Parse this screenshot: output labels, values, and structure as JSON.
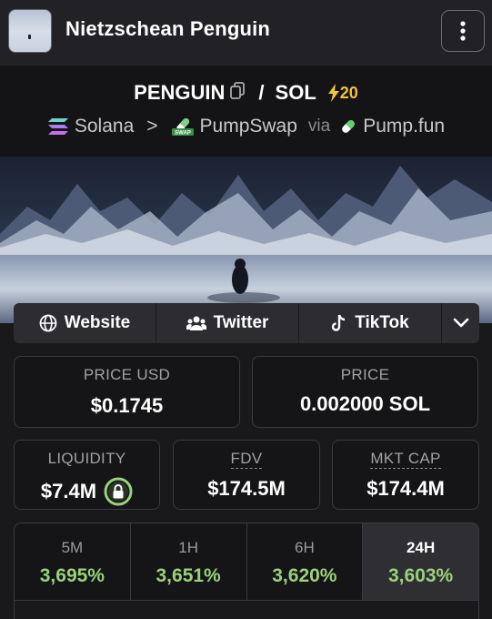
{
  "header": {
    "title": "Nietzschean Penguin",
    "menu_icon": "more-vertical-icon"
  },
  "pair": {
    "base": "PENGUIN",
    "slash": "/",
    "quote": "SOL",
    "boost": "20",
    "boost_color": "#f3c13a"
  },
  "route": {
    "chain": "Solana",
    "separator": ">",
    "dex": "PumpSwap",
    "dex_badge": "SWAP",
    "via": "via",
    "launchpad": "Pump.fun"
  },
  "social": {
    "website": "Website",
    "twitter": "Twitter",
    "tiktok": "TikTok"
  },
  "stats": {
    "price_usd_label": "PRICE USD",
    "price_usd": "$0.1745",
    "price_label": "PRICE",
    "price": "0.002000 SOL",
    "liquidity_label": "LIQUIDITY",
    "liquidity": "$7.4M",
    "fdv_label": "FDV",
    "fdv": "$174.5M",
    "mktcap_label": "MKT CAP",
    "mktcap": "$174.4M"
  },
  "timeframes": [
    {
      "label": "5M",
      "change": "3,695%"
    },
    {
      "label": "1H",
      "change": "3,651%"
    },
    {
      "label": "6H",
      "change": "3,620%"
    },
    {
      "label": "24H",
      "change": "3,603%"
    }
  ],
  "colors": {
    "positive": "#9bd17a",
    "lock_ring": "#9bd17a"
  }
}
